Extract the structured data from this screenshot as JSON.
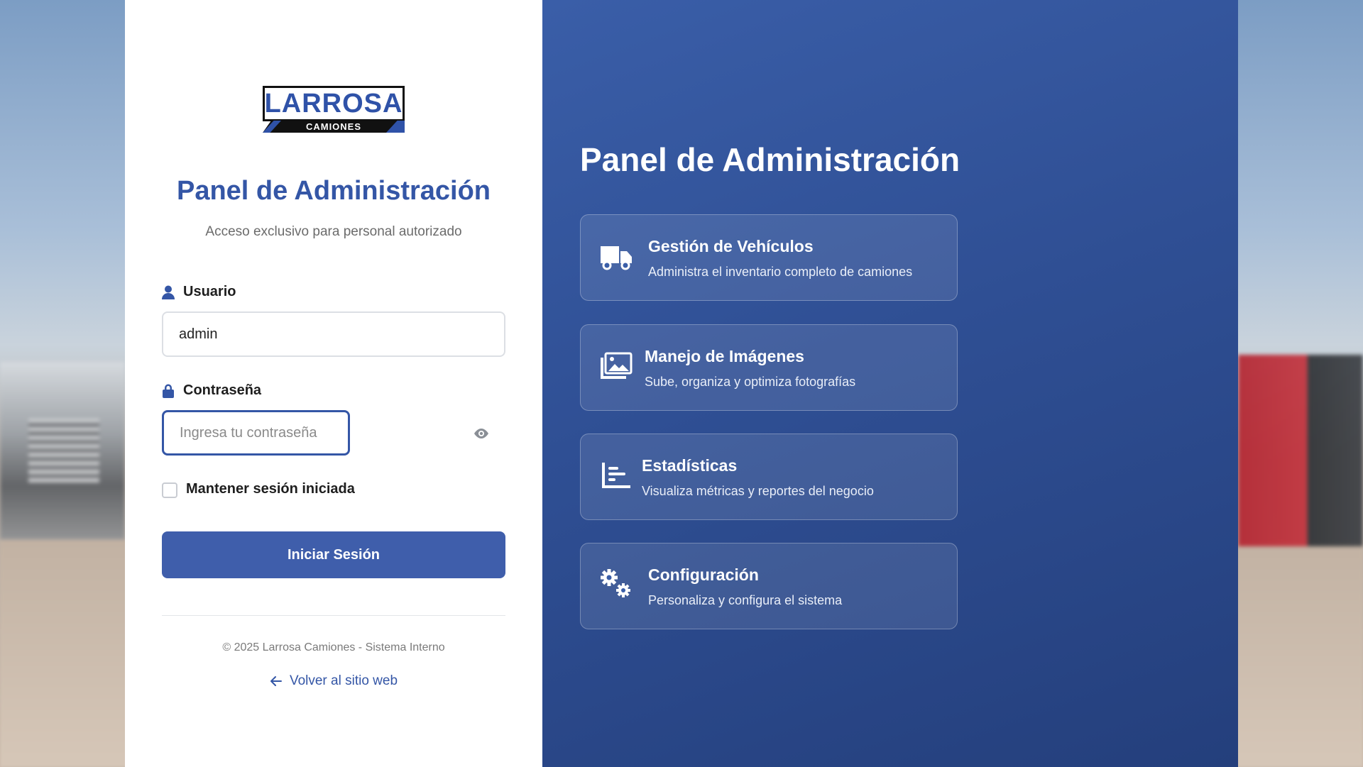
{
  "brand": {
    "name": "LARROSA",
    "subname": "CAMIONES",
    "color": "#3456a6"
  },
  "login": {
    "title": "Panel de Administración",
    "subtitle": "Acceso exclusivo para personal autorizado",
    "username_label": "Usuario",
    "username_value": "admin",
    "password_label": "Contraseña",
    "password_placeholder": "Ingresa tu contraseña",
    "remember_label": "Mantener sesión iniciada",
    "submit_label": "Iniciar Sesión",
    "copyright": "© 2025 Larrosa Camiones - Sistema Interno",
    "back_link": "Volver al sitio web"
  },
  "features": {
    "title": "Panel de Administración",
    "items": [
      {
        "title": "Gestión de Vehículos",
        "desc": "Administra el inventario completo de camiones",
        "icon": "truck-icon"
      },
      {
        "title": "Manejo de Imágenes",
        "desc": "Sube, organiza y optimiza fotografías",
        "icon": "images-icon"
      },
      {
        "title": "Estadísticas",
        "desc": "Visualiza métricas y reportes del negocio",
        "icon": "chart-icon"
      },
      {
        "title": "Configuración",
        "desc": "Personaliza y configura el sistema",
        "icon": "gears-icon"
      }
    ]
  }
}
